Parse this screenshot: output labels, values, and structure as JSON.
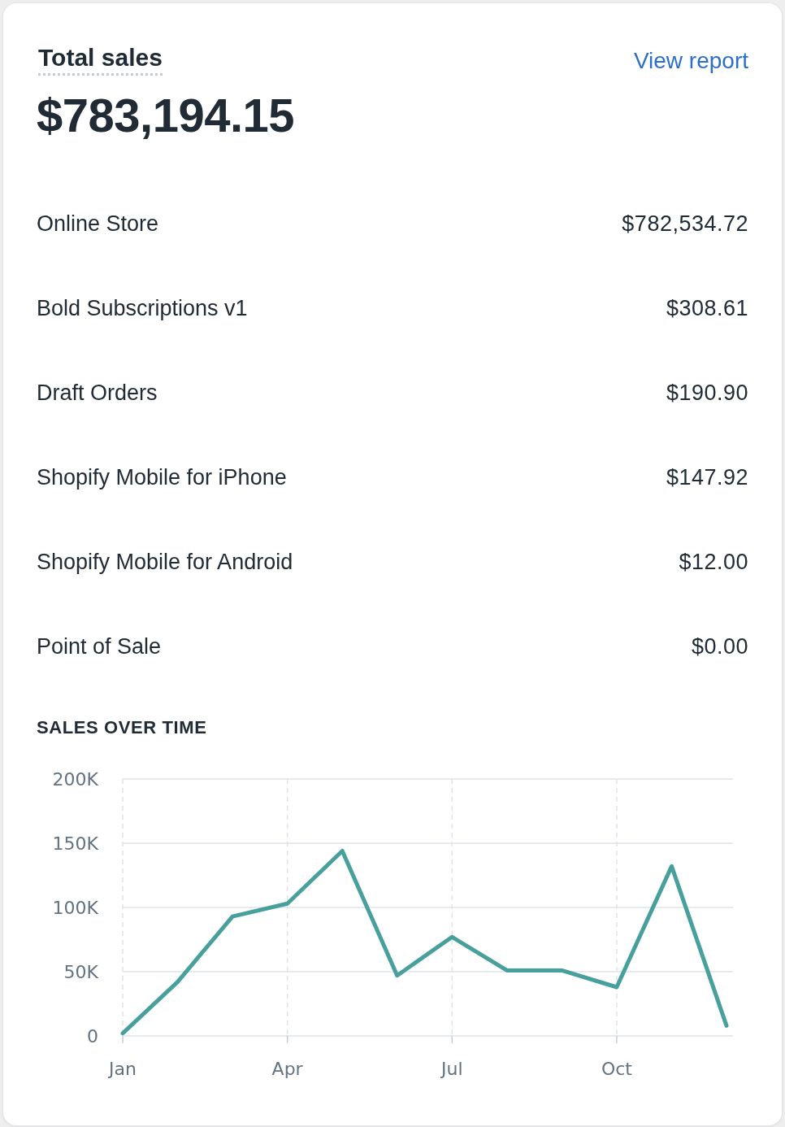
{
  "header": {
    "title": "Total sales",
    "link": "View report",
    "total": "$783,194.15"
  },
  "channels": [
    {
      "label": "Online Store",
      "value": "$782,534.72"
    },
    {
      "label": "Bold Subscriptions v1",
      "value": "$308.61"
    },
    {
      "label": "Draft Orders",
      "value": "$190.90"
    },
    {
      "label": "Shopify Mobile for iPhone",
      "value": "$147.92"
    },
    {
      "label": "Shopify Mobile for Android",
      "value": "$12.00"
    },
    {
      "label": "Point of Sale",
      "value": "$0.00"
    }
  ],
  "chart": {
    "heading": "SALES OVER TIME",
    "chart_data": {
      "type": "line",
      "grid": true,
      "categories": [
        "Jan",
        null,
        null,
        "Apr",
        null,
        null,
        "Jul",
        null,
        null,
        "Oct",
        null,
        null
      ],
      "ylim": [
        0,
        200000
      ],
      "yticks": [
        {
          "value": 0,
          "label": "0"
        },
        {
          "value": 50000,
          "label": "50K"
        },
        {
          "value": 100000,
          "label": "100K"
        },
        {
          "value": 150000,
          "label": "150K"
        },
        {
          "value": 200000,
          "label": "200K"
        }
      ],
      "series": [
        {
          "color": "#47a09c",
          "values": [
            2000,
            42000,
            93000,
            103000,
            144000,
            47000,
            77000,
            51000,
            51000,
            38000,
            132000,
            8000
          ]
        }
      ]
    }
  }
}
